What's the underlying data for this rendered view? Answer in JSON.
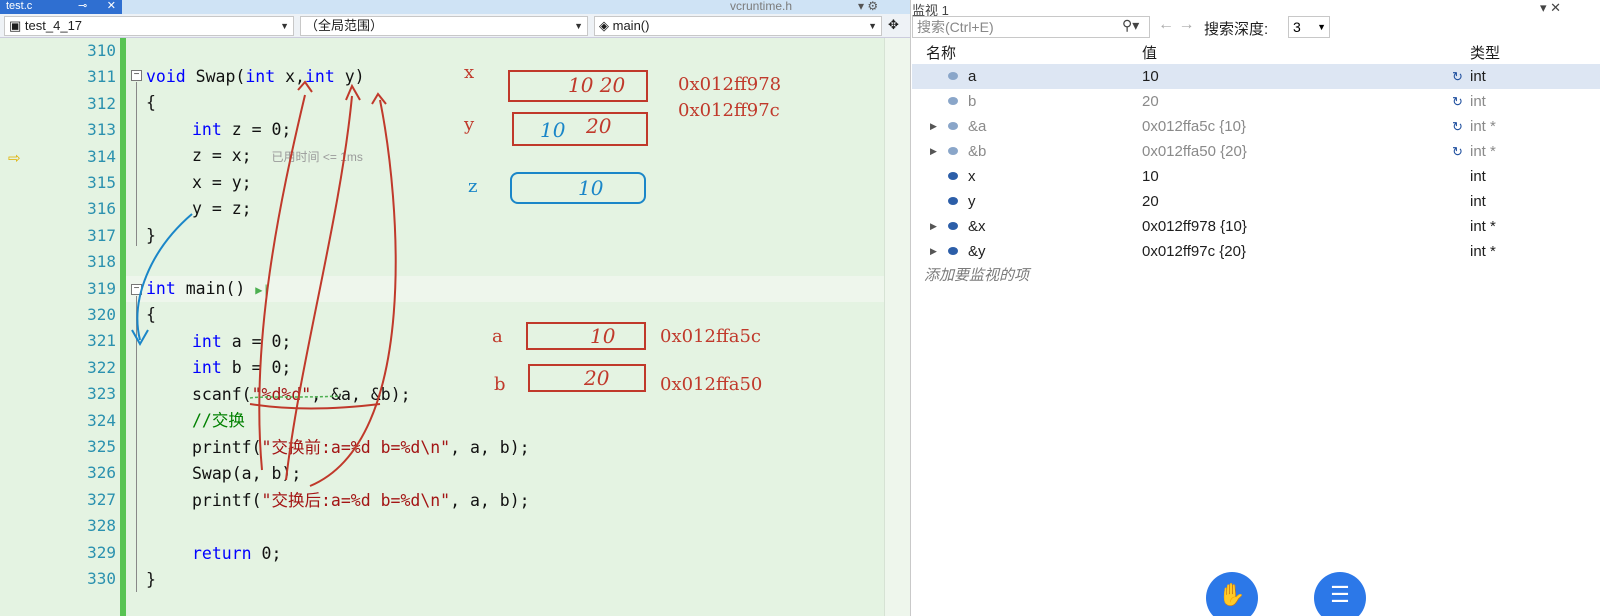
{
  "editor": {
    "tab_label": "test.c",
    "other_tab": "vcruntime.h",
    "nav": {
      "project": "test_4_17",
      "scope": "（全局范围）",
      "function": "main()"
    },
    "line_numbers": [
      "310",
      "311",
      "312",
      "313",
      "314",
      "315",
      "316",
      "317",
      "318",
      "319",
      "320",
      "321",
      "322",
      "323",
      "324",
      "325",
      "326",
      "327",
      "328",
      "329",
      "330"
    ],
    "elapsed_hint": "已用时间 <= 1ms"
  },
  "annotations": {
    "x_label": "x",
    "y_label": "y",
    "z_label": "z",
    "a_label": "a",
    "b_label": "b",
    "x_addr": "0x012ff978",
    "y_addr": "0x012ff97c",
    "a_addr": "0x012ffa5c",
    "b_addr": "0x012ffa50"
  },
  "watch": {
    "title": "监视 1",
    "search_placeholder": "搜索(Ctrl+E)",
    "depth_label": "搜索深度:",
    "depth_value": "3",
    "col_name": "名称",
    "col_value": "值",
    "col_type": "类型",
    "rows": [
      {
        "name": "a",
        "value": "10",
        "type": "int"
      },
      {
        "name": "b",
        "value": "20",
        "type": "int"
      },
      {
        "name": "&a",
        "value": "0x012ffa5c {10}",
        "type": "int *"
      },
      {
        "name": "&b",
        "value": "0x012ffa50 {20}",
        "type": "int *"
      },
      {
        "name": "x",
        "value": "10",
        "type": "int"
      },
      {
        "name": "y",
        "value": "20",
        "type": "int"
      },
      {
        "name": "&x",
        "value": "0x012ff978 {10}",
        "type": "int *"
      },
      {
        "name": "&y",
        "value": "0x012ff97c {20}",
        "type": "int *"
      }
    ],
    "add_item": "添加要监视的项"
  }
}
